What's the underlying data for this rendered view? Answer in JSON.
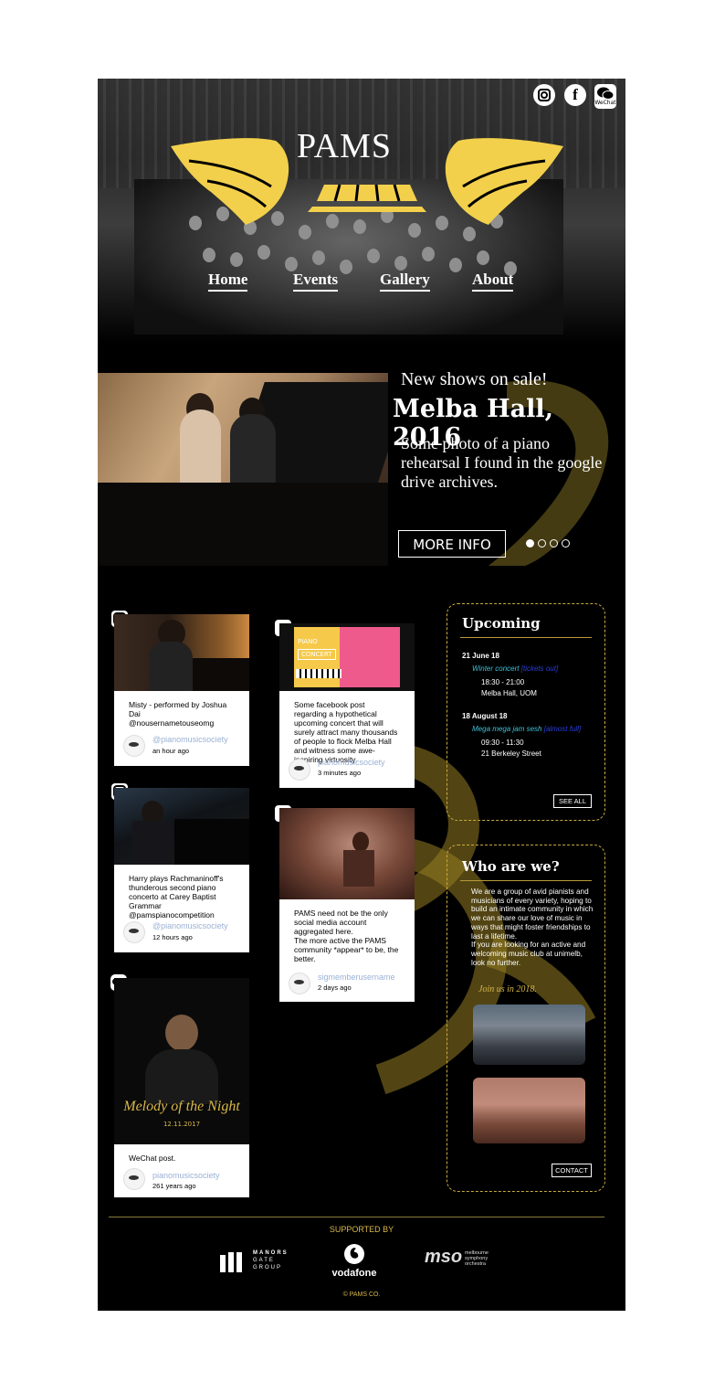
{
  "brand": {
    "logo_text": "PAMS",
    "gold": "#f2d04b"
  },
  "social": {
    "instagram_icon": "instagram-icon",
    "facebook_label": "f",
    "wechat_label": "WeChat"
  },
  "nav": {
    "items": [
      "Home",
      "Events",
      "Gallery",
      "About"
    ]
  },
  "feature": {
    "subtitle": "New shows on sale!",
    "title": "Melba Hall, 2016",
    "description": "Some photo of a piano rehearsal I found in the google drive archives.",
    "button": "MORE INFO",
    "carousel_active": 1,
    "carousel_count": 4
  },
  "feed": {
    "instagram1": {
      "text": "Misty - performed by Joshua Dai\n@nousernametouseomg",
      "user": "@pianomusicsociety",
      "time": "an hour ago"
    },
    "instagram2": {
      "text": "Harry plays Rachmaninoff's thunderous second piano concerto at Carey Baptist Grammar\n@pamspianocompetition",
      "user": "@pianomusicsociety",
      "time": "12 hours ago"
    },
    "wechat1": {
      "text": "WeChat post.",
      "user": "pianomusicsociety",
      "time": "261 years ago",
      "poster_title": "Melody of the Night",
      "poster_date": "12.11.2017"
    },
    "facebook1": {
      "text": "Some facebook post regarding a hypothetical upcoming concert that will surely attract many thousands of people to flock Melba Hall and witness some awe-inspiring virtuosity.",
      "user": "pianomusicsociety",
      "time": "3 minutes ago",
      "poster_word": "CONCERT",
      "poster_word2": "PIANO"
    },
    "facebook2": {
      "text": "PAMS need not be the only social media account aggregated here.\nThe more active the PAMS community *appear* to be, the better.",
      "user": "sigmemberusername",
      "time": "2 days ago"
    }
  },
  "upcoming": {
    "title": "Upcoming",
    "events": [
      {
        "date": "21 June 18",
        "name": "Winter concert",
        "tag": "[tickets out]",
        "time": "18:30 - 21:00",
        "venue": "Melba Hall, UOM"
      },
      {
        "date": "18 August 18",
        "name": "Mega mega jam sesh",
        "tag": "[almost full]",
        "time": "09:30 - 11:30",
        "venue": "21 Berkeley Street"
      }
    ],
    "see_all": "SEE ALL"
  },
  "about": {
    "title": "Who are we?",
    "text": "We are a group of avid pianists and musicians of every variety, hoping to build an intimate community in which we can share our love of music in ways that might foster friendships to last a lifetime.\nIf you are looking for an active and welcoming music club at unimelb, look no further.",
    "join": "Join us in 2018.",
    "contact": "CONTACT"
  },
  "footer": {
    "supported_by": "SUPPORTED BY",
    "sponsors": {
      "manors_line1": "MANORS",
      "manors_line2": "GATE",
      "manors_line3": "GROUP",
      "vodafone": "vodafone",
      "mso": "mso",
      "mso_line1": "melbourne",
      "mso_line2": "symphony",
      "mso_line3": "orchestra"
    },
    "copyright": "© PAMS CO."
  }
}
